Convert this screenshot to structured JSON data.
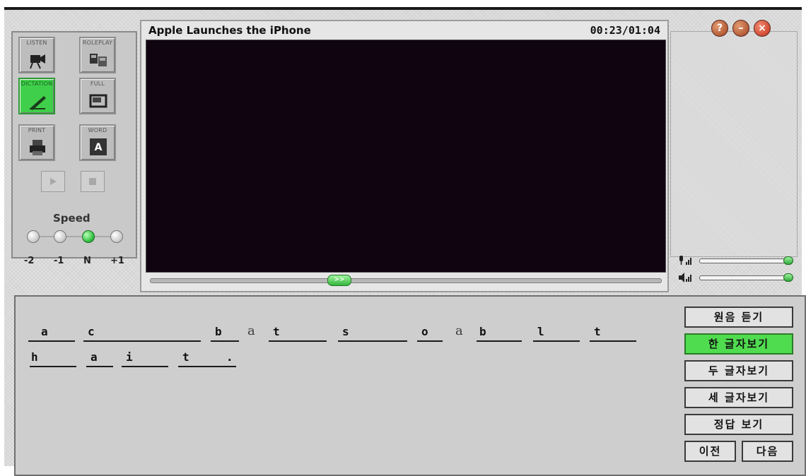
{
  "video": {
    "title": "Apple Launches the iPhone",
    "time": "00:23/01:04",
    "seek_handle_label": ">>"
  },
  "modes": [
    {
      "label": "LISTEN",
      "icon": "video-camera-icon",
      "active": false
    },
    {
      "label": "ROLEPLAY",
      "icon": "roleplay-icon",
      "active": false
    },
    {
      "label": "DICTATION",
      "icon": "pencil-icon",
      "active": true
    },
    {
      "label": "FULL",
      "icon": "fullscreen-icon",
      "active": false
    },
    {
      "label": "PRINT",
      "icon": "printer-icon",
      "active": false
    },
    {
      "label": "WORD",
      "icon": "word-book-icon",
      "active": false
    }
  ],
  "word_icon_letter": "A",
  "speed": {
    "title": "Speed",
    "levels": [
      "-2",
      "-1",
      "N",
      "+1"
    ],
    "selected": "N"
  },
  "window_buttons": {
    "help": "?",
    "minimize": "–",
    "close": "×"
  },
  "dictation": {
    "line1": [
      "a",
      "c",
      "",
      "b",
      "a",
      "t",
      "s",
      "o",
      "a",
      "b",
      "l",
      "t"
    ],
    "line2": [
      "h",
      "a",
      "i",
      "t",
      "."
    ]
  },
  "buttons": {
    "original": "원음 듣기",
    "one_letter": "한 글자보기",
    "two_letters": "두 글자보기",
    "three_letters": "세 글자보기",
    "answer": "정답 보기",
    "prev": "이전",
    "next": "다음"
  },
  "colors": {
    "active_green": "#3fcf4a",
    "video_bg": "#0f0410",
    "close_red": "#d9442a"
  }
}
